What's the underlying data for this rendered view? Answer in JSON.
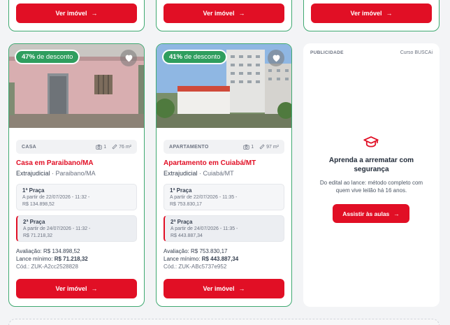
{
  "top_row": {
    "buttons": [
      "Ver imóvel",
      "Ver imóvel",
      "Ver imóvel"
    ]
  },
  "cards": [
    {
      "discount_pct": "47%",
      "discount_label": "de desconto",
      "type": "CASA",
      "photos": "1",
      "area": "76 m²",
      "title": "Casa em Paraibano/MA",
      "modality": "Extrajudicial",
      "location": "· Paraibano/MA",
      "praca1": {
        "label": "1ª Praça",
        "date": "A partir de 22/07/2026 - 11:32 -",
        "value": "R$ 134.898,52"
      },
      "praca2": {
        "label": "2ª Praça",
        "date": "A partir de 24/07/2026 - 11:32 -",
        "value": "R$ 71.218,32"
      },
      "avaliacao_label": "Avaliação:",
      "avaliacao": "R$ 134.898,52",
      "lance_label": "Lance mínimo:",
      "lance": "R$ 71.218,32",
      "codigo": "Cód.: ZUK-A2cc2528828",
      "button": "Ver imóvel"
    },
    {
      "discount_pct": "41%",
      "discount_label": "de desconto",
      "type": "APARTAMENTO",
      "photos": "1",
      "area": "97 m²",
      "title": "Apartamento em Cuiabá/MT",
      "modality": "Extrajudicial",
      "location": "· Cuiabá/MT",
      "praca1": {
        "label": "1ª Praça",
        "date": "A partir de 22/07/2026 - 11:35 -",
        "value": "R$ 753.830,17"
      },
      "praca2": {
        "label": "2ª Praça",
        "date": "A partir de 24/07/2026 - 11:35 -",
        "value": "R$ 443.887,34"
      },
      "avaliacao_label": "Avaliação:",
      "avaliacao": "R$ 753.830,17",
      "lance_label": "Lance mínimo:",
      "lance": "R$ 443.887,34",
      "codigo": "Cód.: ZUK-ABc5737e952",
      "button": "Ver imóvel"
    }
  ],
  "ad": {
    "label": "PUBLICIDADE",
    "sponsor": "Curso BUSCAi",
    "headline": "Aprenda a arrematar com segurança",
    "body": "Do edital ao lance: método completo com quem vive leilão há 16 anos.",
    "button": "Assistir às aulas"
  },
  "colors": {
    "accent_red": "#e10f25",
    "discount_green": "#2f9e5e",
    "card_border_green": "#3fa971"
  }
}
